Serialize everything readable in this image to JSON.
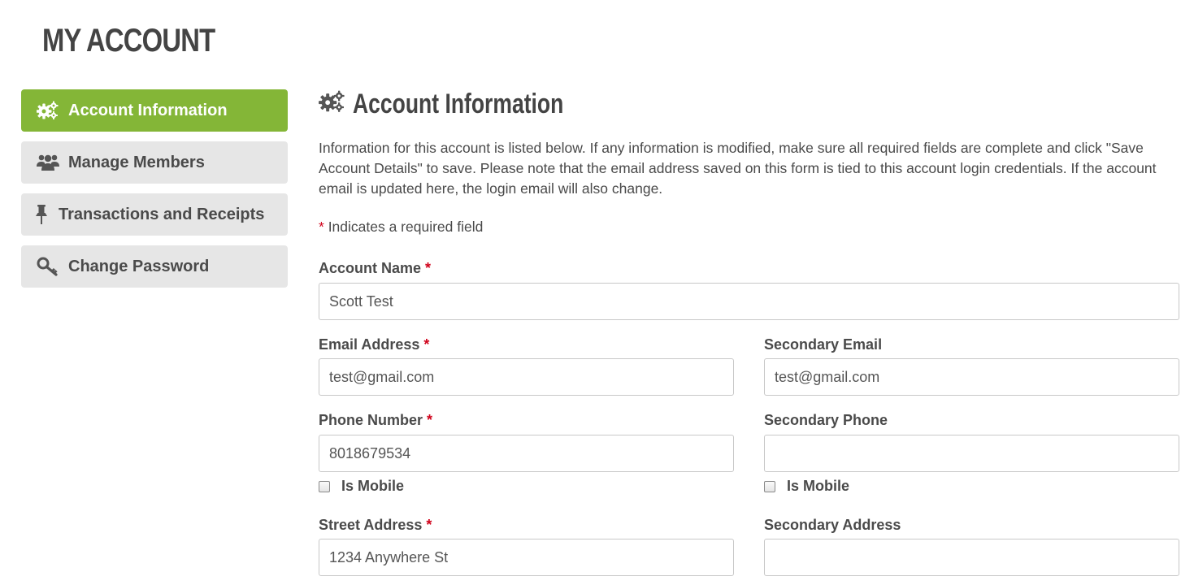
{
  "page": {
    "title": "MY ACCOUNT"
  },
  "colors": {
    "accent": "#84b637",
    "required": "#d0021b",
    "nav_bg": "#e6e6e6"
  },
  "sidebar": {
    "items": [
      {
        "label": "Account Information",
        "icon": "gears-icon",
        "active": true
      },
      {
        "label": "Manage Members",
        "icon": "users-icon",
        "active": false
      },
      {
        "label": "Transactions and Receipts",
        "icon": "pin-icon",
        "active": false
      },
      {
        "label": "Change Password",
        "icon": "key-icon",
        "active": false
      }
    ]
  },
  "main": {
    "section_title": "Account Information",
    "section_icon": "gears-icon",
    "intro": "Information for this account is listed below. If any information is modified, make sure all required fields are complete and click \"Save Account Details\" to save. Please note that the email address saved on this form is tied to this account login credentials. If the account email is updated here, the login email will also change.",
    "required_star": "*",
    "required_note": "Indicates a required field"
  },
  "form": {
    "account_name": {
      "label": "Account Name",
      "value": "Scott Test"
    },
    "email": {
      "label": "Email Address",
      "value": "test@gmail.com"
    },
    "secondary_email": {
      "label": "Secondary Email",
      "value": "test@gmail.com"
    },
    "phone": {
      "label": "Phone Number",
      "value": "8018679534",
      "mobile_label": "Is Mobile"
    },
    "secondary_phone": {
      "label": "Secondary Phone",
      "value": "",
      "mobile_label": "Is Mobile"
    },
    "street_address": {
      "label": "Street Address",
      "value": "1234 Anywhere St"
    },
    "secondary_address": {
      "label": "Secondary Address",
      "value": ""
    }
  }
}
